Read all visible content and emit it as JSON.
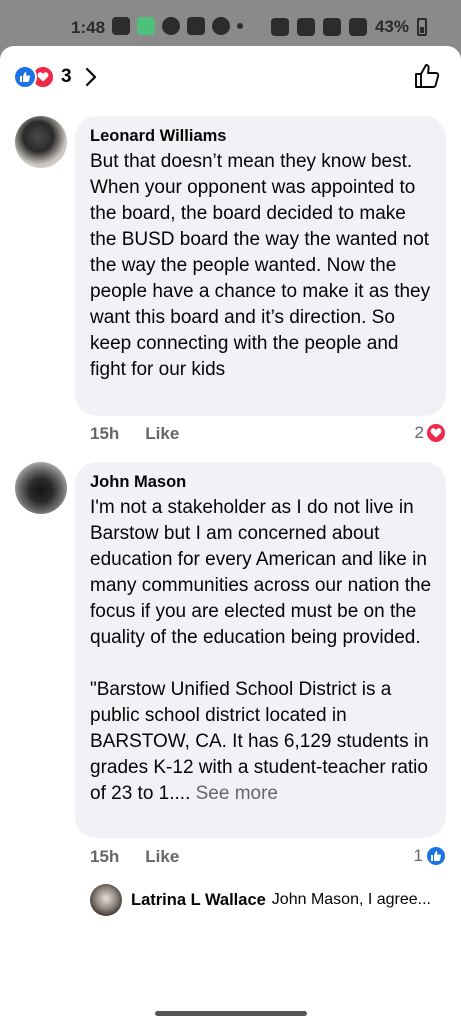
{
  "status_bar": {
    "time": "1:48",
    "battery": "43%"
  },
  "header": {
    "reaction_count": "3"
  },
  "comments": [
    {
      "author": "Leonard Williams",
      "text": "But that doesn’t mean they know best. When your opponent was appointed to the board, the board decided to make the BUSD board the way the wanted not the way the people wanted. Now the people have a chance to make it as they want this board and it’s direction. So keep connecting with the people and fight for our kids",
      "time": "15h",
      "like_label": "Like",
      "reaction_count": "2"
    },
    {
      "author": "John Mason",
      "text": "I'm not a stakeholder as I do not live in Barstow but I am concerned about education for every American and like in many communities across our nation the focus if you are elected must be on the quality of the education being provided.\n\n\"Barstow Unified School District is a public school district located in BARSTOW, CA. It has 6,129 students in grades K-12 with a student-teacher ratio of 23 to 1.... ",
      "see_more": "See more",
      "time": "15h",
      "like_label": "Like",
      "reaction_count": "1",
      "reply": {
        "author": "Latrina L Wallace",
        "preview": "John Mason, I agree..."
      }
    }
  ],
  "colors": {
    "like_blue": "#1b74e4",
    "love_red": "#f0284a",
    "bubble_bg": "#f0f2f5",
    "meta_gray": "#65676b"
  }
}
